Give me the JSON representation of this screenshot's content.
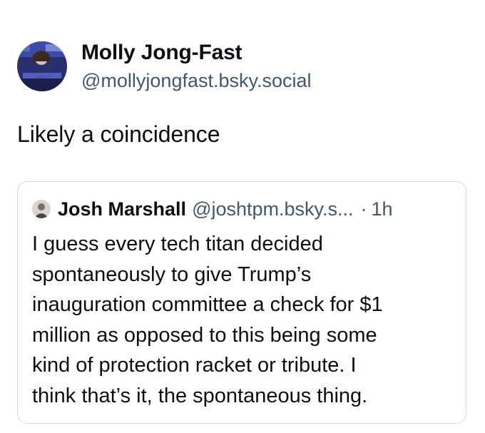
{
  "post": {
    "author": {
      "display_name": "Molly Jong-Fast",
      "handle": "@mollyjongfast.bsky.social"
    },
    "text": "Likely a coincidence"
  },
  "quote": {
    "author": {
      "display_name": "Josh Marshall",
      "handle": "@joshtpm.bsky.s...",
      "separator": "·",
      "time": "1h"
    },
    "lines": [
      "I guess every tech titan decided",
      "spontaneously to give Trump’s",
      "inauguration committee a check for $1",
      "million as opposed to this being some",
      "kind of protection racket or tribute. I",
      "think that’s it, the spontaneous thing."
    ]
  },
  "colors": {
    "text_primary": "#0b0f14",
    "text_secondary": "#42576c",
    "card_border": "#d4dbe2"
  },
  "icons": {
    "author_avatar": "avatar-photo",
    "quote_avatar": "avatar-photo"
  }
}
